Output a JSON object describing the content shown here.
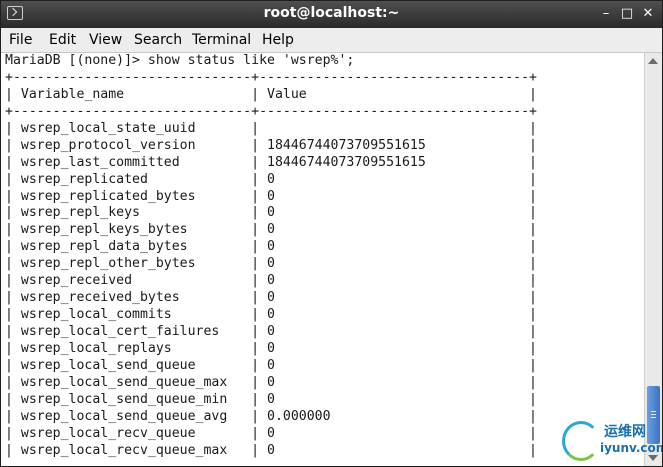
{
  "window": {
    "title": "root@localhost:~",
    "minimize_icon": "–",
    "maximize_icon": "□",
    "close_icon": "✕"
  },
  "menu": {
    "items": [
      "File",
      "Edit",
      "View",
      "Search",
      "Terminal",
      "Help"
    ]
  },
  "terminal": {
    "lines": [
      "MariaDB [(none)]> show status like 'wsrep%';",
      "+------------------------------+----------------------------------+",
      "| Variable_name                | Value                            |",
      "+------------------------------+----------------------------------+",
      "| wsrep_local_state_uuid       |                                  |",
      "| wsrep_protocol_version       | 18446744073709551615             |",
      "| wsrep_last_committed         | 18446744073709551615             |",
      "| wsrep_replicated             | 0                                |",
      "| wsrep_replicated_bytes       | 0                                |",
      "| wsrep_repl_keys              | 0                                |",
      "| wsrep_repl_keys_bytes        | 0                                |",
      "| wsrep_repl_data_bytes        | 0                                |",
      "| wsrep_repl_other_bytes       | 0                                |",
      "| wsrep_received               | 0                                |",
      "| wsrep_received_bytes         | 0                                |",
      "| wsrep_local_commits          | 0                                |",
      "| wsrep_local_cert_failures    | 0                                |",
      "| wsrep_local_replays          | 0                                |",
      "| wsrep_local_send_queue       | 0                                |",
      "| wsrep_local_send_queue_max   | 0                                |",
      "| wsrep_local_send_queue_min   | 0                                |",
      "| wsrep_local_send_queue_avg   | 0.000000                         |",
      "| wsrep_local_recv_queue       | 0                                |",
      "| wsrep_local_recv_queue_max   | 0                                |"
    ]
  },
  "watermark": {
    "chinese": "运维网",
    "url": "iyunv.com"
  }
}
